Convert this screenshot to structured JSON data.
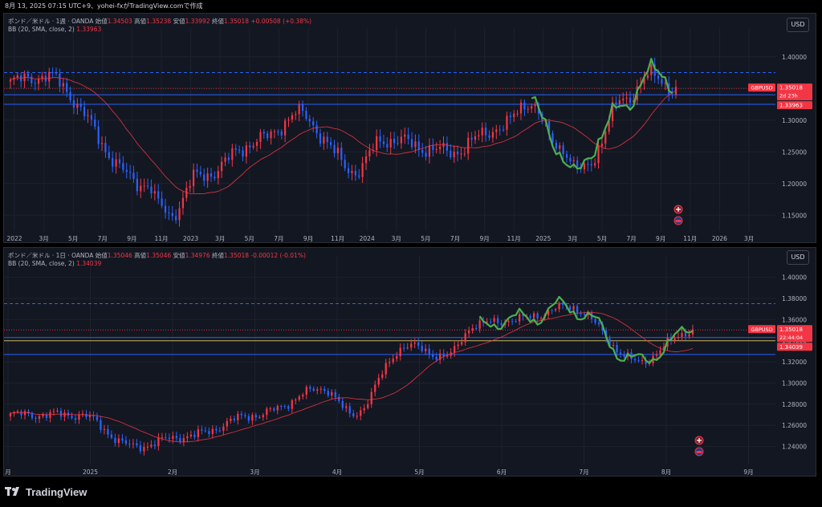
{
  "header": {
    "text": "8月 13, 2025 07:15 UTC+9、yohei-fxがTradingView.comで作成"
  },
  "panes": [
    {
      "id": "weekly",
      "symbol_line": "ポンド／米ドル · 1週 · OANDA",
      "ohlc": {
        "o_label": "始値",
        "o": "1.34503",
        "h_label": "高値",
        "h": "1.35238",
        "l_label": "安値",
        "l": "1.33992",
        "c_label": "終値",
        "c": "1.35018",
        "chg": "+0.00508 (+0.38%)"
      },
      "bb_label": "BB (20, SMA, close, 2)",
      "bb_value": "1.33963",
      "currency_button": "USD",
      "price_ticks": [
        "1.40000",
        "1.35000",
        "1.30000",
        "1.25000",
        "1.20000",
        "1.15000"
      ],
      "price_min": 1.125,
      "price_max": 1.42,
      "time_ticks": [
        "2022",
        "3月",
        "5月",
        "7月",
        "9月",
        "11月",
        "2023",
        "3月",
        "5月",
        "7月",
        "9月",
        "11月",
        "2024",
        "3月",
        "5月",
        "7月",
        "9月",
        "11月",
        "2025",
        "3月",
        "5月",
        "7月",
        "9月",
        "11月",
        "2026",
        "3月"
      ],
      "price_labels": [
        {
          "text": "GBPUSD",
          "kind": "symbol"
        },
        {
          "text": "1.35018",
          "kind": "price"
        },
        {
          "text": "2d 23h",
          "kind": "countdown"
        },
        {
          "text": "1.33963",
          "kind": "bb"
        }
      ],
      "levels": {
        "dashed": 1.375,
        "solid_upper": 1.34,
        "solid_lower": 1.325,
        "last": 1.35018
      },
      "event_icons": [
        "gb-flag-icon",
        "us-flag-icon"
      ]
    },
    {
      "id": "daily",
      "symbol_line": "ポンド／米ドル · 1日 · OANDA",
      "ohlc": {
        "o_label": "始値",
        "o": "1.35046",
        "h_label": "高値",
        "h": "1.35046",
        "l_label": "安値",
        "l": "1.34976",
        "c_label": "終値",
        "c": "1.35018",
        "chg": "-0.00012 (-0.01%)"
      },
      "bb_label": "BB (20, SMA, close, 2)",
      "bb_value": "1.34039",
      "currency_button": "USD",
      "price_ticks": [
        "1.40000",
        "1.38000",
        "1.36000",
        "1.34000",
        "1.32000",
        "1.30000",
        "1.28000",
        "1.26000",
        "1.24000"
      ],
      "price_min": 1.223,
      "price_max": 1.405,
      "time_ticks": [
        "月",
        "2025",
        "2月",
        "3月",
        "4月",
        "5月",
        "6月",
        "7月",
        "8月",
        "9月"
      ],
      "price_labels": [
        {
          "text": "GBPUSD",
          "kind": "symbol"
        },
        {
          "text": "1.35018",
          "kind": "price"
        },
        {
          "text": "22:44:04",
          "kind": "countdown"
        },
        {
          "text": "1.34039",
          "kind": "bb"
        }
      ],
      "levels": {
        "dashed": 1.375,
        "solid_upper": 1.343,
        "solid_lower": 1.327,
        "yellow": 1.34,
        "last": 1.35018
      },
      "event_icons": [
        "gb-flag-icon",
        "us-flag-icon"
      ]
    }
  ],
  "footer": {
    "brand": "TradingView"
  },
  "colors": {
    "bg": "#131722",
    "up": "#f23645",
    "down": "#2962ff",
    "bb": "#f23645",
    "wave": "#4caf50",
    "level": "#2962ff",
    "yellow": "#c9b458"
  }
}
